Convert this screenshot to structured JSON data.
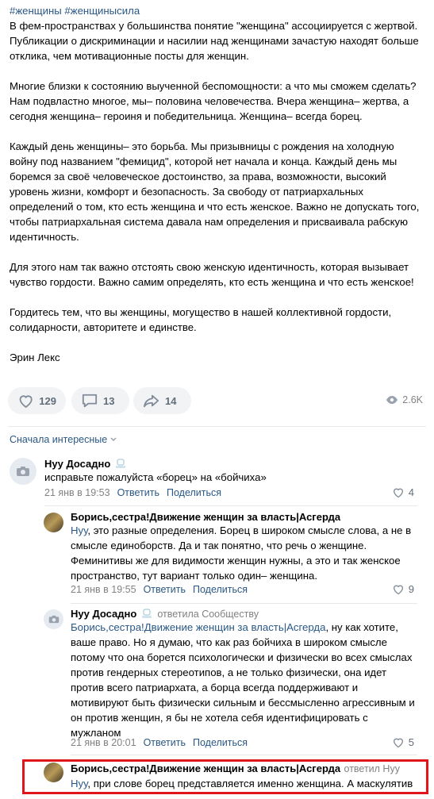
{
  "post": {
    "tags": "#женщины #женщинысила",
    "paragraphs": [
      "В фем-пространствах у большинства понятие \"женщина\" ассоциируется с жертвой. Публикации о дискриминации и насилии над женщинами зачастую находят больше отклика, чем мотивационные посты для женщин.",
      "Многие близки к состоянию выученной беспомощности: а что мы сможем сделать? Нам подвластно многое, мы– половина человечества. Вчера женщина– жертва, а сегодня женщина– героиня и победительница. Женщина– всегда борец.",
      "Каждый день женщины– это борьба. Мы призывницы с рождения на холодную войну под названием \"фемицид\", которой нет начала и конца. Каждый день мы боремся за своё человеческое достоинство, за права, возможности, высокий уровень жизни, комфорт и безопасность. За свободу от патриархальных определений о том, кто есть женщина и что есть женское. Важно не допускать того, чтобы патриархальная система давала нам определения и присваивала рабскую идентичность.",
      "Для этого нам так важно отстоять свою женскую идентичность, которая вызывает чувство гордости. Важно самим определять, кто есть женщина и что есть женское!",
      "Гордитесь тем, что вы женщины, могущество в нашей коллективной гордости, солидарности, авторитете и единстве.",
      "Эрин Лекс"
    ],
    "likes": "129",
    "comments": "13",
    "shares": "14",
    "views": "2.6K"
  },
  "sort_label": "Сначала интересные",
  "comments": [
    {
      "author": "Нуу Досадно",
      "text": "исправьте пожалуйста «борец» на «бойчиха»",
      "date": "21 янв в 19:53",
      "reply": "Ответить",
      "share": "Поделиться",
      "likes": "4"
    },
    {
      "author": "Борись,сестра!Движение женщин за власть|Асгерда",
      "mention": "Нуу",
      "text": ", это разные определения. Борец в широком смысле слова, а не в смысле единоборств. Да и так понятно, что речь о женщине. Феминитивы же для видимости женщин нужны, а это и так женское пространство, тут вариант только один– женщина.",
      "date": "21 янв в 19:55",
      "reply": "Ответить",
      "share": "Поделиться",
      "likes": "9"
    },
    {
      "author": "Нуу Досадно",
      "replied_to": "ответила Сообществу",
      "mention": "Борись,сестра!Движение женщин за власть|Асгерда",
      "text": ", ну как хотите, ваше право. Но я думаю, что как раз бойчиха в широком смысле потому что она борется психологически и физически во всех смыслах против гендерных стереотипов, а не только физически, она идет против всего патриархата, а борца всегда поддерживают и мотивируют быть физически сильным и бессмысленно агрессивным и он против женщин, я бы не хотела себя идентифицировать с мужланом",
      "date": "21 янв в 20:01",
      "reply": "Ответить",
      "share": "Поделиться",
      "likes": "5"
    },
    {
      "author": "Борись,сестра!Движение женщин за власть|Асгерда",
      "replied_to": "ответил Нуу",
      "mention": "Нуу",
      "text": ", при слове борец представляется именно женщина. А маскулятив"
    }
  ],
  "colors": {
    "link": "#2a5885",
    "meta": "#828282",
    "highlight": "#e0161b"
  }
}
